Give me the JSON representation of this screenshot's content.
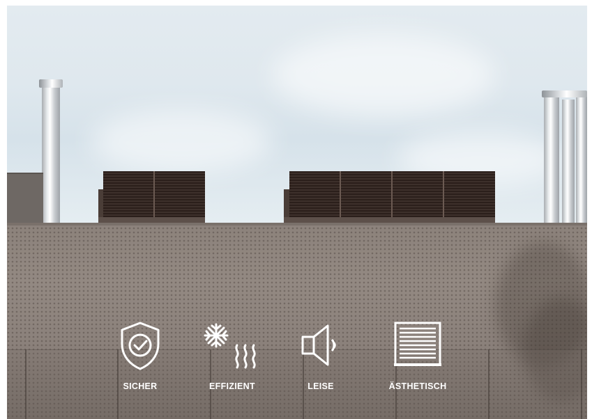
{
  "features": [
    {
      "label": "SICHER",
      "icon": "shield-check-icon"
    },
    {
      "label": "EFFIZIENT",
      "icon": "snowflake-heat-icon"
    },
    {
      "label": "LEISE",
      "icon": "speaker-icon"
    },
    {
      "label": "ÄSTHETISCH",
      "icon": "louvre-grille-icon"
    }
  ],
  "colors": {
    "label": "#ffffff",
    "icon": "#ffffff",
    "facade": "#8c827b",
    "louvre": "#2b1f1b",
    "sky": "#e3ebf0"
  }
}
